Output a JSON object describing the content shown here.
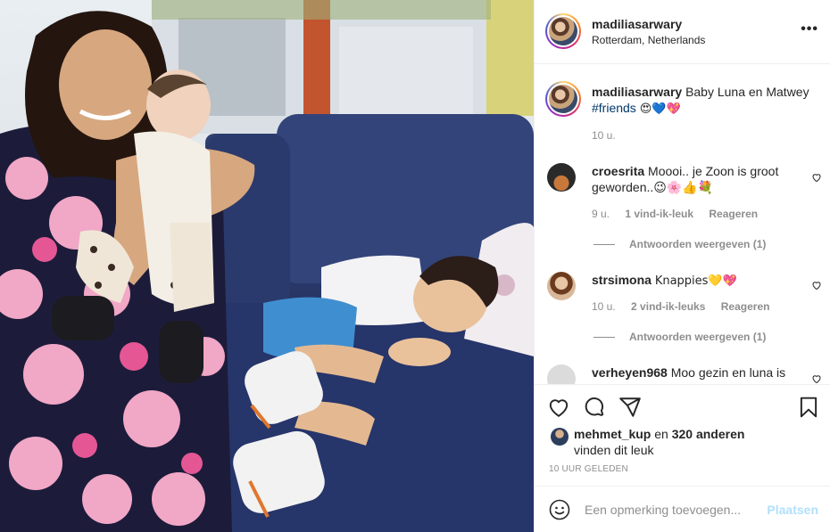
{
  "header": {
    "username": "madiliasarwary",
    "location": "Rotterdam, Netherlands",
    "more_label": "•••"
  },
  "caption": {
    "username": "madiliasarwary",
    "text": "Baby Luna en Matwey",
    "hashtag": "#friends",
    "emojis": "😍💙💖",
    "time": "10 u."
  },
  "comments": [
    {
      "username": "croesrita",
      "text": "Moooi.. je Zoon is groot geworden..😉🌸👍💐",
      "time": "9 u.",
      "likes": "1 vind-ik-leuk",
      "reply_label": "Reageren",
      "view_replies": "Antwoorden weergeven (1)"
    },
    {
      "username": "strsimona",
      "text": "Knappies💛💖",
      "time": "10 u.",
      "likes": "2 vind-ik-leuks",
      "reply_label": "Reageren",
      "view_replies": "Antwoorden weergeven (1)"
    },
    {
      "username": "verheyen968",
      "text": "Moo gezin en luna is"
    }
  ],
  "likes": {
    "user": "mehmet_kup",
    "connector": "en",
    "others": "320 anderen",
    "suffix": "vinden dit leuk"
  },
  "timestamp": "10 UUR GELEDEN",
  "add_comment": {
    "placeholder": "Een opmerking toevoegen...",
    "post_label": "Plaatsen"
  },
  "icons": {
    "like": "heart-icon",
    "comment": "comment-icon",
    "share": "paper-plane-icon",
    "save": "bookmark-icon",
    "emoji": "smiley-icon",
    "more": "more-options-icon"
  },
  "colors": {
    "text": "#262626",
    "muted": "#8e8e8e",
    "hashtag": "#00376b",
    "post_button_disabled": "#b2dffc",
    "border": "#efefef"
  }
}
